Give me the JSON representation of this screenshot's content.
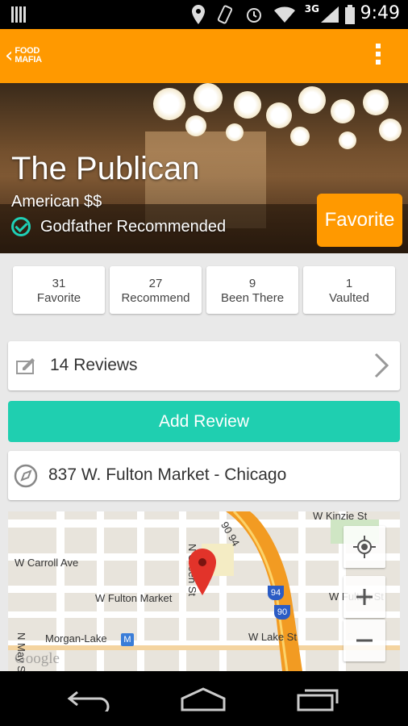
{
  "status_bar": {
    "network": "3G",
    "time": "9:49",
    "icons": [
      "location-icon",
      "vibrate-icon",
      "alarm-icon",
      "wifi-icon",
      "signal-icon",
      "battery-icon"
    ]
  },
  "app_bar": {
    "logo_line1": "FOOD",
    "logo_line2": "MAFIA",
    "back_icon": "chevron-left-icon",
    "menu_icon": "overflow-menu-icon"
  },
  "restaurant": {
    "name": "The Publican",
    "cuisine": "American $$",
    "badge": "Godfather Recommended",
    "favorite_label": "Favorite"
  },
  "stats": [
    {
      "count": "31",
      "label": "Favorite"
    },
    {
      "count": "27",
      "label": "Recommend"
    },
    {
      "count": "9",
      "label": "Been There"
    },
    {
      "count": "1",
      "label": "Vaulted"
    }
  ],
  "reviews": {
    "label": "14 Reviews",
    "icon": "edit-icon"
  },
  "add_review_label": "Add Review",
  "address": {
    "label": "837 W. Fulton Market - Chicago",
    "icon": "compass-icon"
  },
  "map": {
    "streets": [
      "W Kinzie St",
      "W Carroll Ave",
      "N Green St",
      "W Fulton Market",
      "W Fulton St",
      "Morgan-Lake",
      "W Lake St",
      "N May St",
      "90 94"
    ],
    "shields": [
      "94",
      "90"
    ],
    "metro_badge": "M",
    "attribution": "Google"
  },
  "colors": {
    "accent": "#ff9900",
    "teal": "#1fcfb0"
  }
}
